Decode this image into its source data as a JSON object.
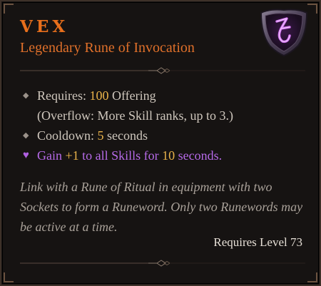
{
  "item": {
    "name": "VEX",
    "type": "Legendary Rune of Invocation",
    "icon": "rune-shield-icon"
  },
  "stats": {
    "requires_label": "Requires: ",
    "requires_value": "100",
    "requires_unit": " Offering",
    "overflow": "(Overflow: More Skill ranks, up to 3.)",
    "cooldown_label": "Cooldown: ",
    "cooldown_value": "5",
    "cooldown_unit": " seconds",
    "effect_prefix": "Gain ",
    "effect_bonus": "+1",
    "effect_middle": " to all Skills for ",
    "effect_duration": "10",
    "effect_suffix": " seconds."
  },
  "flavor": "Link with a Rune of Ritual in equipment with two Sockets to form a Runeword. Only two Runewords may be active at a time.",
  "requirement": "Requires Level 73",
  "colors": {
    "name": "#e86f1c",
    "value": "#e8b24a",
    "effect": "#b66ae8",
    "background": "#161312"
  }
}
